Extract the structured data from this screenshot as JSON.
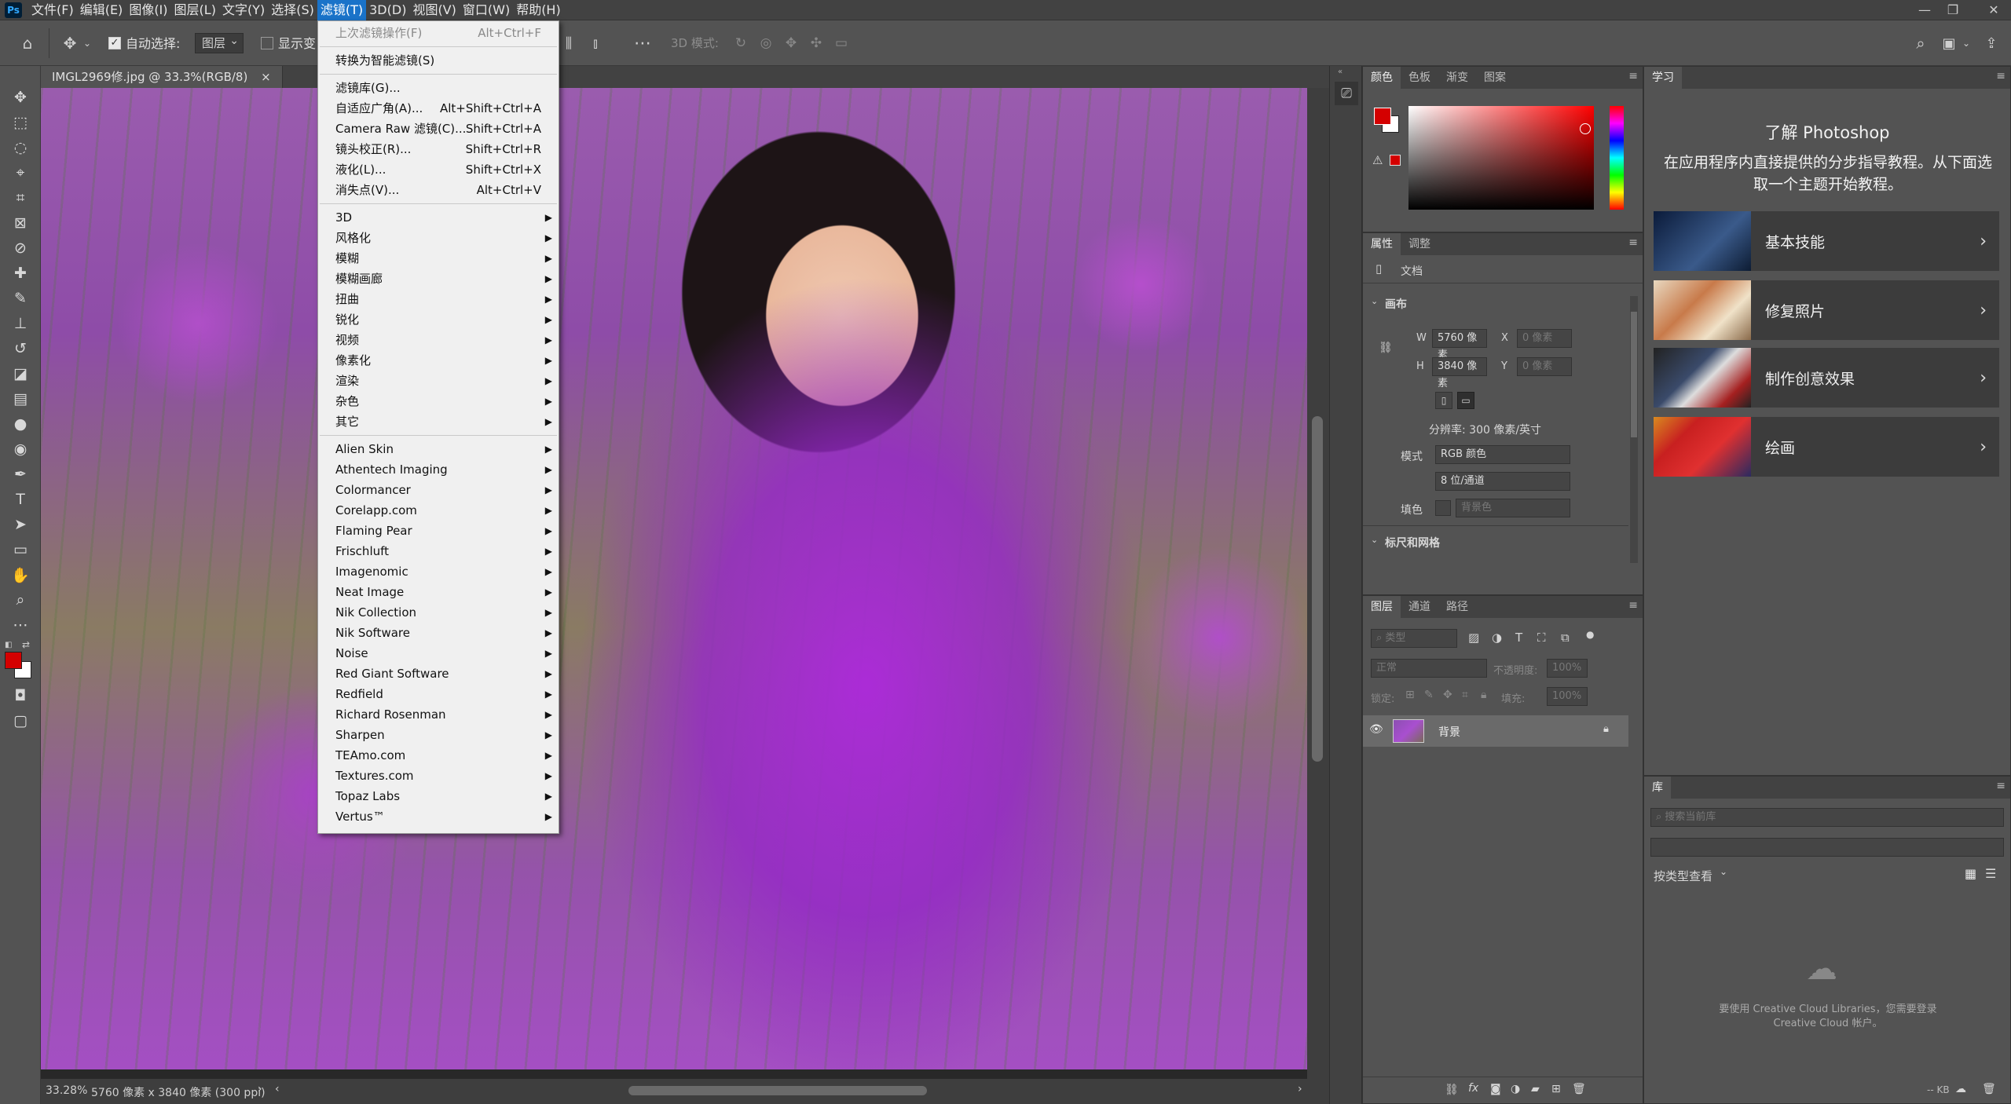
{
  "app": {
    "logo": "Ps"
  },
  "menubar": {
    "items": [
      "文件(F)",
      "编辑(E)",
      "图像(I)",
      "图层(L)",
      "文字(Y)",
      "选择(S)",
      "滤镜(T)",
      "3D(D)",
      "视图(V)",
      "窗口(W)",
      "帮助(H)"
    ],
    "active_index": 6
  },
  "window_controls": {
    "minimize": "—",
    "restore": "❐",
    "close": "✕"
  },
  "options": {
    "auto_select_label": "自动选择:",
    "auto_select_value": "图层",
    "show_transform_label": "显示变",
    "mode_3d_label": "3D 模式:"
  },
  "document": {
    "tab_title": "IMGL2969修.jpg @ 33.3%(RGB/8)",
    "tab_close": "×",
    "zoom": "33.28%",
    "size_info": "5760 像素 x 3840 像素 (300 ppi)"
  },
  "filter_menu": {
    "top_items": [
      {
        "label": "上次滤镜操作(F)",
        "shortcut": "Alt+Ctrl+F",
        "disabled": true
      },
      {
        "label": "转换为智能滤镜(S)",
        "shortcut": ""
      }
    ],
    "filter_items": [
      {
        "label": "滤镜库(G)...",
        "shortcut": ""
      },
      {
        "label": "自适应广角(A)...",
        "shortcut": "Alt+Shift+Ctrl+A"
      },
      {
        "label": "Camera Raw 滤镜(C)...",
        "shortcut": "Shift+Ctrl+A"
      },
      {
        "label": "镜头校正(R)...",
        "shortcut": "Shift+Ctrl+R"
      },
      {
        "label": "液化(L)...",
        "shortcut": "Shift+Ctrl+X"
      },
      {
        "label": "消失点(V)...",
        "shortcut": "Alt+Ctrl+V"
      }
    ],
    "builtin_submenus": [
      "3D",
      "风格化",
      "模糊",
      "模糊画廊",
      "扭曲",
      "锐化",
      "视频",
      "像素化",
      "渲染",
      "杂色",
      "其它"
    ],
    "plugin_submenus": [
      "Alien Skin",
      "Athentech Imaging",
      "Colormancer",
      "Corelapp.com",
      "Flaming Pear",
      "Frischluft",
      "Imagenomic",
      "Neat Image",
      "Nik Collection",
      "Nik Software",
      "Noise",
      "Red Giant Software",
      "Redfield",
      "Richard Rosenman",
      "Sharpen",
      "TEAmo.com",
      "Textures.com",
      "Topaz Labs",
      "Vertus™"
    ]
  },
  "color_panel": {
    "tabs": [
      "颜色",
      "色板",
      "渐变",
      "图案"
    ],
    "fg_color": "#d40000",
    "bg_color": "#ffffff"
  },
  "properties_panel": {
    "tabs": [
      "属性",
      "调整"
    ],
    "doc_label": "文档",
    "canvas_section": "画布",
    "w_label": "W",
    "w_value": "5760 像素",
    "h_label": "H",
    "h_value": "3840 像素",
    "x_label": "X",
    "x_placeholder": "0 像素",
    "y_label": "Y",
    "y_placeholder": "0 像素",
    "resolution": "分辨率: 300 像素/英寸",
    "mode_label": "模式",
    "mode_value": "RGB 颜色",
    "bit_value": "8 位/通道",
    "fill_label": "填色",
    "fill_value": "背景色",
    "rulers_section": "标尺和网格"
  },
  "layers_panel": {
    "tabs": [
      "图层",
      "通道",
      "路径"
    ],
    "filter_placeholder": "类型",
    "blend_mode": "正常",
    "opacity_label": "不透明度:",
    "opacity_value": "100%",
    "lock_label": "锁定:",
    "fill_label": "填充:",
    "fill_value": "100%",
    "layer_name": "背景"
  },
  "learn_panel": {
    "tab": "学习",
    "title": "了解 Photoshop",
    "subtitle": "在应用程序内直接提供的分步指导教程。从下面选取一个主题开始教程。",
    "cards": [
      "基本技能",
      "修复照片",
      "制作创意效果",
      "绘画"
    ]
  },
  "libraries_panel": {
    "tab": "库",
    "search_placeholder": "搜索当前库",
    "view_by": "按类型查看",
    "message": "要使用 Creative Cloud Libraries，您需要登录 Creative Cloud 帐户。",
    "size_label": "-- KB"
  }
}
